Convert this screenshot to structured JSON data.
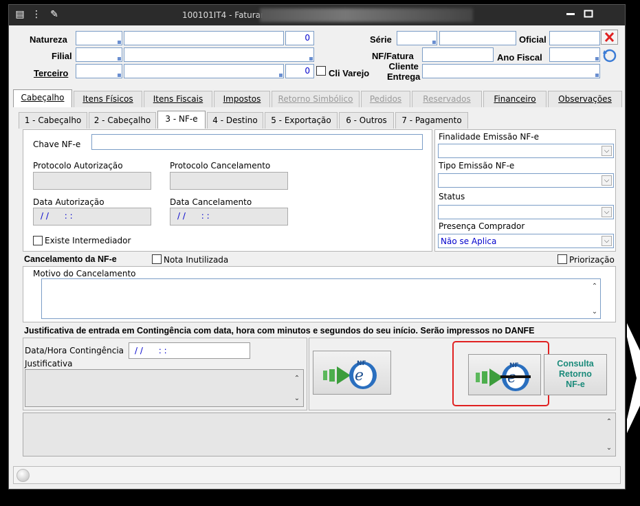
{
  "window": {
    "title": "100101IT4 - Faturamento"
  },
  "header": {
    "natureza_label": "Natureza",
    "natureza_value": "0",
    "filial_label": "Filial",
    "terceiro_label": "Terceiro",
    "terceiro_value": "0",
    "cli_varejo_label": "Cli Varejo",
    "serie_label": "Série",
    "oficial_label": "Oficial",
    "nf_fatura_label": "NF/Fatura",
    "ano_fiscal_label": "Ano Fiscal",
    "cliente_entrega_label_1": "Cliente",
    "cliente_entrega_label_2": "Entrega"
  },
  "main_tabs": [
    {
      "label": "Cabeçalho",
      "state": "active"
    },
    {
      "label": "Itens Físicos",
      "state": "normal"
    },
    {
      "label": "Itens Fiscais",
      "state": "normal"
    },
    {
      "label": "Impostos",
      "state": "normal"
    },
    {
      "label": "Retorno Simbólico",
      "state": "disabled"
    },
    {
      "label": "Pedidos",
      "state": "disabled"
    },
    {
      "label": "Reservados",
      "state": "disabled"
    },
    {
      "label": "Financeiro",
      "state": "normal"
    },
    {
      "label": "Observações",
      "state": "normal"
    }
  ],
  "sub_tabs": [
    {
      "label": "1 - Cabeçalho",
      "state": "normal"
    },
    {
      "label": "2 - Cabeçalho",
      "state": "normal"
    },
    {
      "label": "3 - NF-e",
      "state": "active"
    },
    {
      "label": "4 - Destino",
      "state": "normal"
    },
    {
      "label": "5 - Exportação",
      "state": "normal"
    },
    {
      "label": "6 - Outros",
      "state": "normal"
    },
    {
      "label": "7 - Pagamento",
      "state": "normal"
    }
  ],
  "nfe": {
    "chave_label": "Chave NF-e",
    "protocolo_autorizacao_label": "Protocolo Autorização",
    "protocolo_cancelamento_label": "Protocolo Cancelamento",
    "data_autorizacao_label": "Data Autorização",
    "data_autorizacao_value": "/ /      : :",
    "data_cancelamento_label": "Data Cancelamento",
    "data_cancelamento_value": "/ /      : :",
    "existe_intermediador_label": "Existe Intermediador",
    "finalidade_label": "Finalidade Emissão NF-e",
    "tipo_emissao_label": "Tipo Emissão NF-e",
    "status_label": "Status",
    "presenca_label": "Presença Comprador",
    "presenca_value": "Não se Aplica"
  },
  "cancelamento": {
    "title": "Cancelamento da NF-e",
    "nota_inutilizada_label": "Nota Inutilizada",
    "priorizacao_label": "Priorização",
    "motivo_label": "Motivo do Cancelamento"
  },
  "contingencia": {
    "title": "Justificativa de entrada em Contingência com data, hora com minutos e segundos do seu início. Serão impressos no DANFE",
    "data_hora_label": "Data/Hora Contingência",
    "data_hora_value": "/ /      : :",
    "justificativa_label": "Justificativa",
    "consulta_label_1": "Consulta",
    "consulta_label_2": "Retorno",
    "consulta_label_3": "NF-e"
  },
  "colors": {
    "titlebar": "#2b2b2b",
    "field_border": "#7a9cc6",
    "value_blue": "#0000cc",
    "highlight_red": "#e02020",
    "consulta_text": "#1a8a7a"
  }
}
